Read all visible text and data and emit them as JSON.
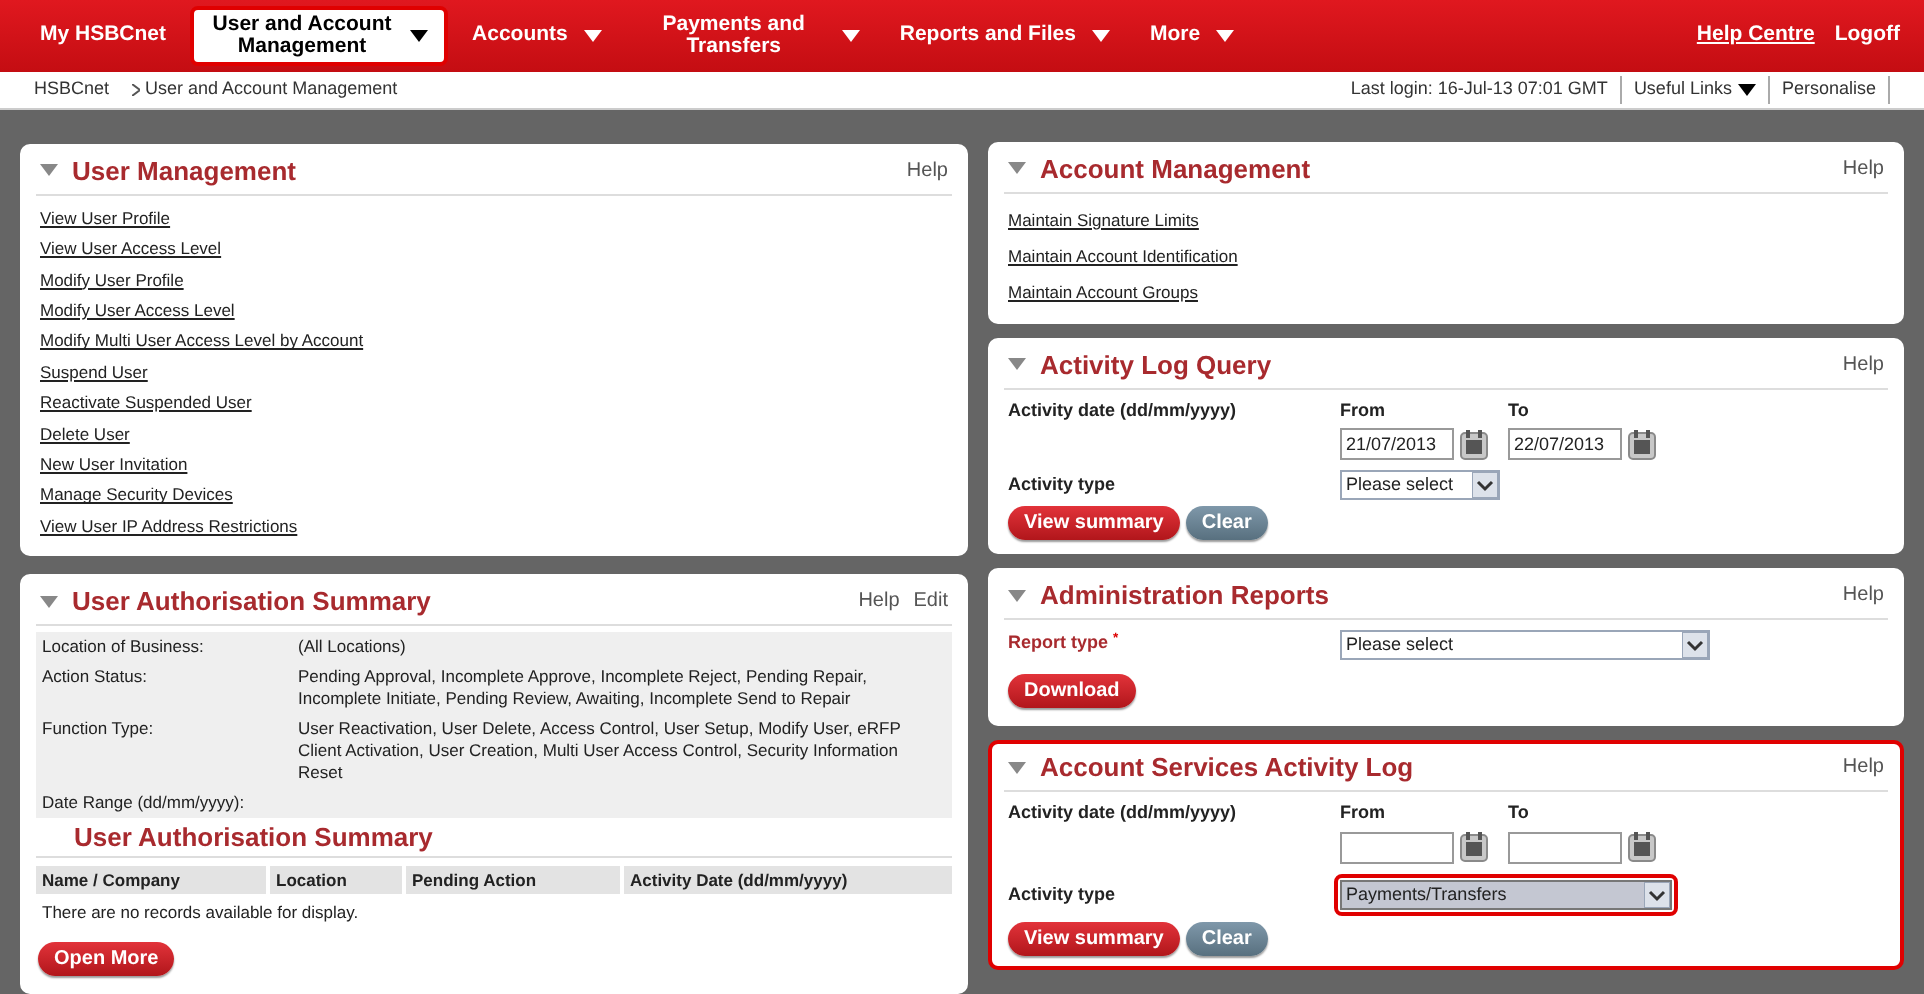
{
  "nav": {
    "items": [
      {
        "label": "My HSBCnet",
        "selected": false,
        "dropdown": false
      },
      {
        "label": "User and Account Management",
        "selected": true,
        "dropdown": true
      },
      {
        "label": "Accounts",
        "selected": false,
        "dropdown": true
      },
      {
        "label": "Payments and Transfers",
        "selected": false,
        "dropdown": true
      },
      {
        "label": "Reports and Files",
        "selected": false,
        "dropdown": true
      },
      {
        "label": "More",
        "selected": false,
        "dropdown": true
      }
    ],
    "links": [
      {
        "label": "Help Centre",
        "underlined": true
      },
      {
        "label": "Logoff",
        "underlined": false
      }
    ]
  },
  "breadcrumb": [
    "HSBCnet",
    "User and Account Management"
  ],
  "header_right": {
    "last_login": "Last login: 16-Jul-13 07:01 GMT",
    "useful_links": "Useful Links",
    "personalise": "Personalise"
  },
  "left_panels": [
    {
      "kind": "links",
      "title": "User Management",
      "highlighted": false,
      "actions": [
        "Help"
      ],
      "links": [
        "View User Profile",
        "View User Access Level",
        "Modify User Profile",
        "Modify User Access Level",
        "Modify Multi User Access Level by Account",
        "Suspend User",
        "Reactivate Suspended User",
        "Delete User",
        "New User Invitation",
        "Manage Security Devices",
        "View User IP Address Restrictions"
      ]
    },
    {
      "kind": "summary",
      "title": "User Authorisation Summary",
      "highlighted": false,
      "actions": [
        "Help",
        "Edit"
      ],
      "filters": [
        {
          "label": "Location of Business:",
          "value": "(All Locations)"
        },
        {
          "label": "Action Status:",
          "value": "Pending Approval, Incomplete Approve, Incomplete Reject, Pending Repair, Incomplete Initiate, Pending Review, Awaiting, Incomplete Send to Repair"
        },
        {
          "label": "Function Type:",
          "value": "User Reactivation, User Delete, Access Control, User Setup, Modify User, eRFP Client Activation, User Creation, Multi User Access Control, Security Information Reset"
        },
        {
          "label": "Date Range (dd/mm/yyyy):"
        }
      ],
      "subtitle": "User Authorisation Summary",
      "columns": [
        "Name / Company",
        "Location",
        "Pending Action",
        "Activity Date (dd/mm/yyyy)"
      ],
      "empty_message": "There are no records available for display.",
      "button": "Open More"
    }
  ],
  "right_panels": [
    {
      "kind": "links",
      "title": "Account Management",
      "highlighted": false,
      "actions": [
        "Help"
      ],
      "links": [
        "Maintain Signature Limits",
        "Maintain Account Identification",
        "Maintain Account Groups"
      ]
    },
    {
      "kind": "query",
      "title": "Activity Log Query",
      "highlighted": false,
      "actions": [
        "Help"
      ],
      "date_label": "Activity date (dd/mm/yyyy)",
      "from_label": "From",
      "to_label": "To",
      "from_value": "21/07/2013",
      "to_value": "22/07/2013",
      "type_label": "Activity type",
      "type_select": {
        "value": "Please select",
        "highlighted": false
      },
      "buttons": [
        {
          "label": "View summary",
          "kind": "primary"
        },
        {
          "label": "Clear",
          "kind": "secondary"
        }
      ]
    },
    {
      "kind": "report",
      "title": "Administration Reports",
      "highlighted": false,
      "actions": [
        "Help"
      ],
      "label": "Report type",
      "required_mark": "*",
      "select": {
        "value": "Please select",
        "highlighted": false
      },
      "button": "Download"
    },
    {
      "kind": "query",
      "title": "Account Services Activity Log",
      "highlighted": true,
      "actions": [
        "Help"
      ],
      "date_label": "Activity date (dd/mm/yyyy)",
      "from_label": "From",
      "to_label": "To",
      "type_label": "Activity type",
      "type_select": {
        "value": "Payments/Transfers",
        "highlighted": true
      },
      "buttons": [
        {
          "label": "View summary",
          "kind": "primary"
        },
        {
          "label": "Clear",
          "kind": "secondary"
        }
      ]
    }
  ]
}
